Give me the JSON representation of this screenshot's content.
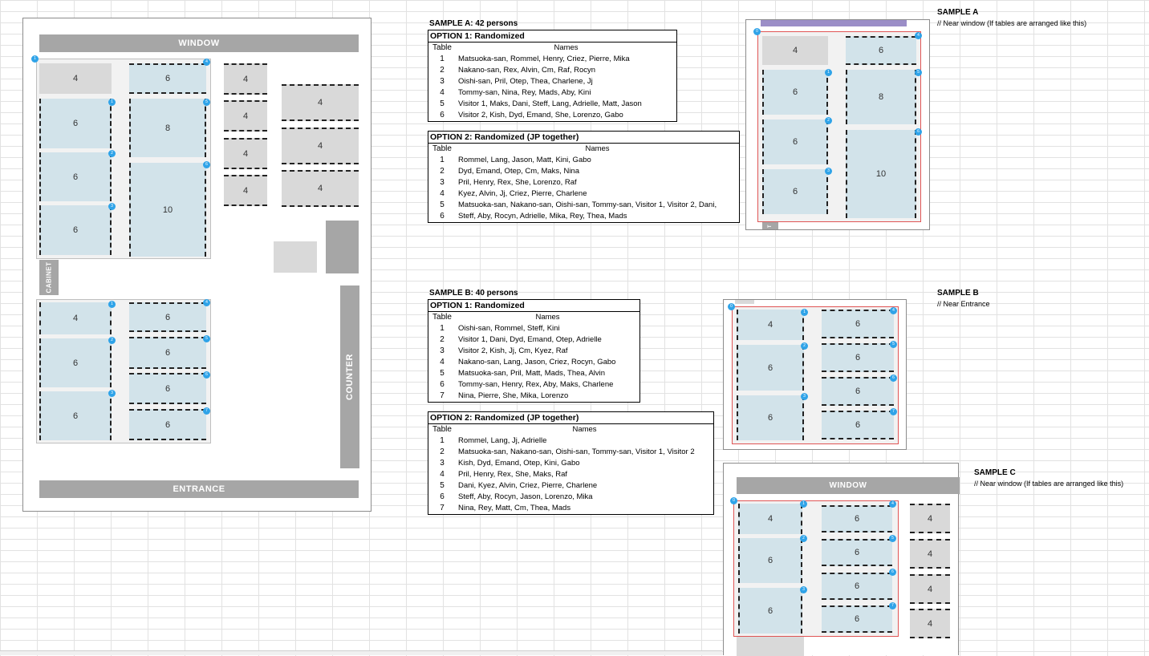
{
  "floor": {
    "window_label": "WINDOW",
    "entrance_label": "ENTRANCE",
    "counter_label": "COUNTER",
    "cabinet_label": "CABINET",
    "top_group": {
      "left": [
        {
          "num": "4",
          "dot": "1"
        },
        {
          "num": "6",
          "dot": "1"
        },
        {
          "num": "6",
          "dot": "2"
        },
        {
          "num": "6",
          "dot": "3"
        }
      ],
      "right": [
        {
          "num": "6",
          "dot": "4"
        },
        {
          "num": "8",
          "dot": "5"
        },
        {
          "num": "10",
          "dot": "6"
        }
      ]
    },
    "side_tables": [
      "4",
      "4",
      "4",
      "4"
    ],
    "big_side_tables": [
      "4",
      "4",
      "4"
    ],
    "bottom_group": {
      "left": [
        {
          "num": "4",
          "dot": "1"
        },
        {
          "num": "6",
          "dot": "2"
        },
        {
          "num": "6",
          "dot": "3"
        }
      ],
      "right": [
        {
          "num": "6",
          "dot": "4"
        },
        {
          "num": "6",
          "dot": "5"
        },
        {
          "num": "6",
          "dot": "6"
        },
        {
          "num": "6",
          "dot": "7"
        }
      ]
    }
  },
  "sample_a": {
    "heading": "SAMPLE A: 42 persons",
    "option1": {
      "title": "OPTION 1: Randomized",
      "col_table": "Table",
      "col_names": "Names",
      "rows": [
        {
          "t": "1",
          "n": "Matsuoka-san, Rommel, Henry, Criez, Pierre, Mika"
        },
        {
          "t": "2",
          "n": "Nakano-san, Rex, Alvin, Cm, Raf, Rocyn"
        },
        {
          "t": "3",
          "n": "Oishi-san, Pril, Otep, Thea, Charlene, Jj"
        },
        {
          "t": "4",
          "n": "Tommy-san, Nina, Rey, Mads, Aby, Kini"
        },
        {
          "t": "5",
          "n": "Visitor 1, Maks, Dani, Steff, Lang, Adrielle, Matt, Jason"
        },
        {
          "t": "6",
          "n": "Visitor 2, Kish, Dyd, Emand, She, Lorenzo, Gabo"
        }
      ]
    },
    "option2": {
      "title": "OPTION 2: Randomized (JP together)",
      "col_table": "Table",
      "col_names": "Names",
      "rows": [
        {
          "t": "1",
          "n": "Rommel, Lang, Jason, Matt, Kini, Gabo"
        },
        {
          "t": "2",
          "n": "Dyd, Emand, Otep, Cm, Maks, Nina"
        },
        {
          "t": "3",
          "n": "Pril, Henry, Rex, She, Lorenzo, Raf"
        },
        {
          "t": "4",
          "n": "Kyez, Alvin, Jj, Criez, Pierre, Charlene"
        },
        {
          "t": "5",
          "n": "Matsuoka-san, Nakano-san, Oishi-san, Tommy-san, Visitor 1, Visitor 2, Dani,"
        },
        {
          "t": "6",
          "n": "Steff, Aby, Rocyn, Adrielle, Mika, Rey, Thea, Mads"
        }
      ]
    },
    "side_title": "SAMPLE A",
    "side_note": "// Near window (If tables are arranged like this)",
    "diagram": {
      "left": [
        "4",
        "6",
        "6",
        "6"
      ],
      "right": [
        "6",
        "8",
        "10"
      ],
      "dots": [
        "0",
        "1",
        "2",
        "3",
        "4",
        "5",
        "6"
      ],
      "cabinet_letter": "T"
    }
  },
  "sample_b": {
    "heading": "SAMPLE B: 40 persons",
    "option1": {
      "title": "OPTION 1: Randomized",
      "col_table": "Table",
      "col_names": "Names",
      "rows": [
        {
          "t": "1",
          "n": "Oishi-san, Rommel, Steff, Kini"
        },
        {
          "t": "2",
          "n": "Visitor 1, Dani, Dyd, Emand, Otep, Adrielle"
        },
        {
          "t": "3",
          "n": "Visitor 2, Kish, Jj, Cm, Kyez, Raf"
        },
        {
          "t": "4",
          "n": "Nakano-san, Lang, Jason, Criez, Rocyn, Gabo"
        },
        {
          "t": "5",
          "n": "Matsuoka-san, Pril, Matt, Mads, Thea, Alvin"
        },
        {
          "t": "6",
          "n": "Tommy-san, Henry, Rex, Aby, Maks, Charlene"
        },
        {
          "t": "7",
          "n": "Nina, Pierre, She, Mika, Lorenzo"
        }
      ]
    },
    "option2": {
      "title": "OPTION 2: Randomized (JP together)",
      "col_table": "Table",
      "col_names": "Names",
      "rows": [
        {
          "t": "1",
          "n": "Rommel, Lang, Jj, Adrielle"
        },
        {
          "t": "2",
          "n": "Matsuoka-san, Nakano-san, Oishi-san, Tommy-san, Visitor 1, Visitor 2"
        },
        {
          "t": "3",
          "n": "Kish, Dyd, Emand, Otep, Kini, Gabo"
        },
        {
          "t": "4",
          "n": "Pril, Henry, Rex, She, Maks, Raf"
        },
        {
          "t": "5",
          "n": "Dani, Kyez, Alvin, Criez, Pierre, Charlene"
        },
        {
          "t": "6",
          "n": "Steff, Aby, Rocyn, Jason, Lorenzo, Mika"
        },
        {
          "t": "7",
          "n": "Nina, Rey, Matt, Cm, Thea, Mads"
        }
      ]
    },
    "side_title": "SAMPLE B",
    "side_note": "// Near Entrance",
    "diagram": {
      "left": [
        "4",
        "6",
        "6"
      ],
      "right": [
        "6",
        "6",
        "6",
        "6"
      ],
      "dots": [
        "0",
        "1",
        "2",
        "3",
        "4",
        "5",
        "6",
        "7"
      ]
    }
  },
  "sample_c": {
    "side_title": "SAMPLE C",
    "side_note": "// Near window (If tables are arranged like this)",
    "window_label": "WINDOW",
    "diagram": {
      "left": [
        "4",
        "6",
        "6"
      ],
      "right": [
        "6",
        "6",
        "6",
        "6"
      ],
      "side": [
        "4",
        "4",
        "4",
        "4"
      ],
      "dots": [
        "0",
        "1",
        "2",
        "3",
        "4",
        "5",
        "6",
        "7"
      ]
    }
  }
}
